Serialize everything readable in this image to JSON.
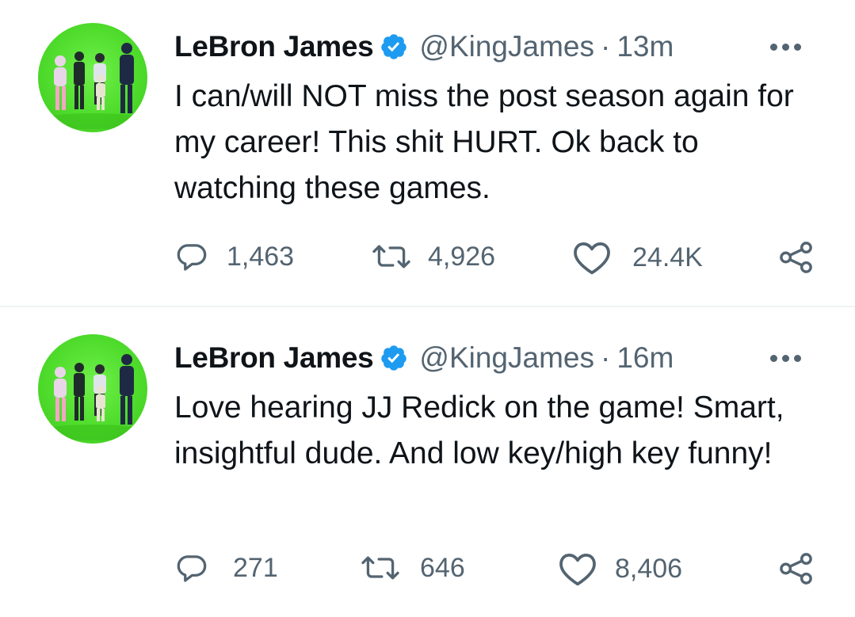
{
  "tweets": [
    {
      "author": {
        "name": "LeBron James",
        "handle": "@KingJames",
        "verified": true
      },
      "separator": "·",
      "time": "13m",
      "text": "I can/will NOT miss the post season again for my career! This shit HURT. Ok back to watching these games.",
      "stats": {
        "replies": "1,463",
        "retweets": "4,926",
        "likes": "24.4K"
      }
    },
    {
      "author": {
        "name": "LeBron James",
        "handle": "@KingJames",
        "verified": true
      },
      "separator": "·",
      "time": "16m",
      "text": "Love hearing JJ Redick on the game! Smart, insightful dude. And low key/high key funny!",
      "stats": {
        "replies": "271",
        "retweets": "646",
        "likes": "8,406"
      }
    }
  ],
  "icons": {
    "verified": "verified-badge-icon",
    "more": "more-dots-icon",
    "reply": "reply-bubble-icon",
    "retweet": "retweet-arrows-icon",
    "like": "heart-icon",
    "share": "share-nodes-icon"
  },
  "colors": {
    "text": "#0f1419",
    "secondary": "#536471",
    "verified": "#1d9bf0",
    "avatar_bg": "#4fdc2c",
    "divider": "#eff3f4"
  }
}
